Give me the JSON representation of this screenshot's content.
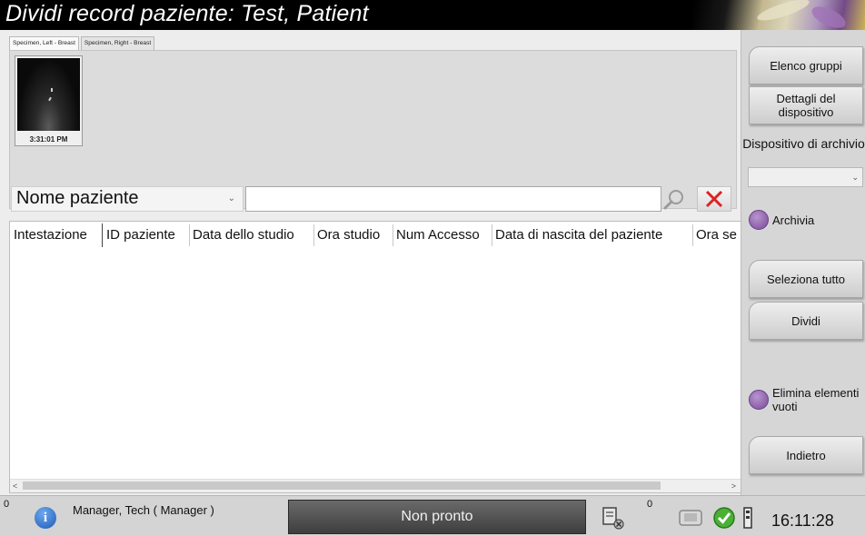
{
  "window": {
    "title": "Dividi record paziente: Test, Patient"
  },
  "tabs": [
    {
      "label": "Specimen, Left - Breast"
    },
    {
      "label": "Specimen, Right - Breast"
    }
  ],
  "thumbnail": {
    "time": "3:31:01 PM"
  },
  "search": {
    "field_selected": "Nome paziente",
    "query": "",
    "search_icon": "magnifier-icon",
    "clear_icon": "red-x-icon"
  },
  "table": {
    "columns": [
      "Intestazione",
      "ID paziente",
      "Data dello studio",
      "Ora studio",
      "Num Accesso",
      "Data di nascita del paziente",
      "Ora se"
    ],
    "rows": []
  },
  "sidebar": {
    "group_list_label": "Elenco gruppi",
    "device_details_label": "Dettagli del dispositivo",
    "archive_device_label": "Dispositivo di archivio",
    "archive_device_value": "",
    "archive_label": "Archivia",
    "select_all_label": "Seleziona tutto",
    "split_label": "Dividi",
    "remove_empty_label": "Elimina elementi vuoti",
    "back_label": "Indietro",
    "accent_color": "#8a5aa8"
  },
  "status": {
    "left_count": "0",
    "user": "Manager, Tech ( Manager )",
    "state": "Non pronto",
    "queue_count": "0",
    "time": "16:11:28",
    "icons": [
      "info-icon",
      "printer-error-icon",
      "archive-queue-icon",
      "ok-check-icon",
      "disk-status-icon"
    ]
  }
}
